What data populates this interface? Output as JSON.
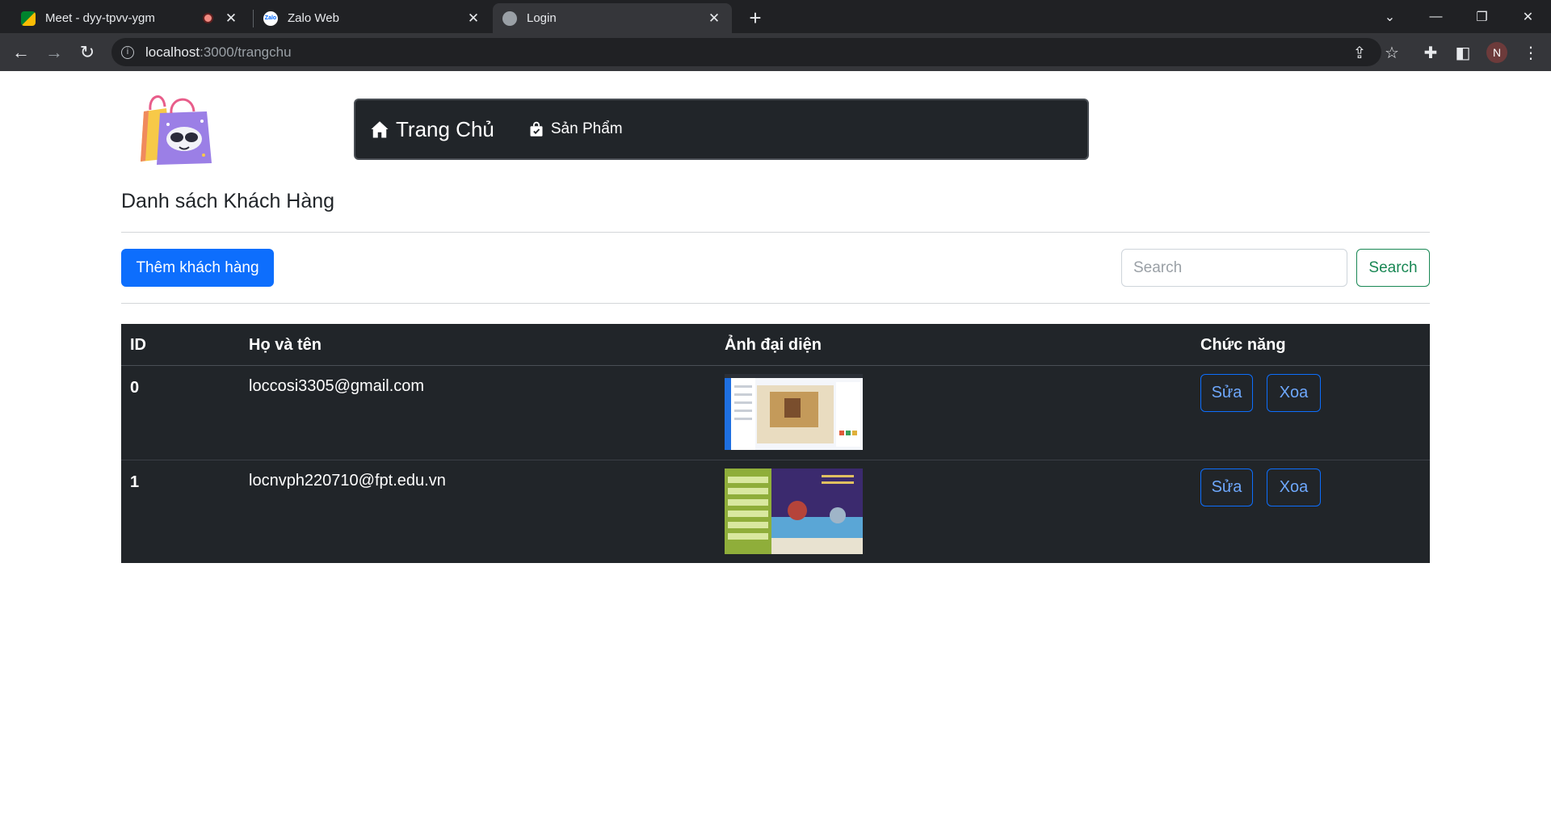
{
  "browser": {
    "tabs": [
      {
        "title": "Meet - dyy-tpvv-ygm",
        "active": false
      },
      {
        "title": "Zalo Web",
        "active": false
      },
      {
        "title": "Login",
        "active": true
      }
    ],
    "url_host": "localhost",
    "url_path": ":3000/trangchu",
    "profile_initial": "N"
  },
  "navbar": {
    "home_label": "Trang Chủ",
    "products_label": "Sản Phẩm"
  },
  "page": {
    "heading": "Danh sách Khách Hàng",
    "add_button": "Thêm khách hàng",
    "search_placeholder": "Search",
    "search_button": "Search"
  },
  "table": {
    "headers": [
      "ID",
      "Họ và tên",
      "Ảnh đại diện",
      "Chức năng"
    ],
    "rows": [
      {
        "id": "0",
        "name": "loccosi3305@gmail.com",
        "edit": "Sửa",
        "delete": "Xoa"
      },
      {
        "id": "1",
        "name": "locnvph220710@fpt.edu.vn",
        "edit": "Sửa",
        "delete": "Xoa"
      }
    ]
  },
  "colors": {
    "primary": "#0d6efd",
    "success": "#198754",
    "dark": "#212529"
  }
}
